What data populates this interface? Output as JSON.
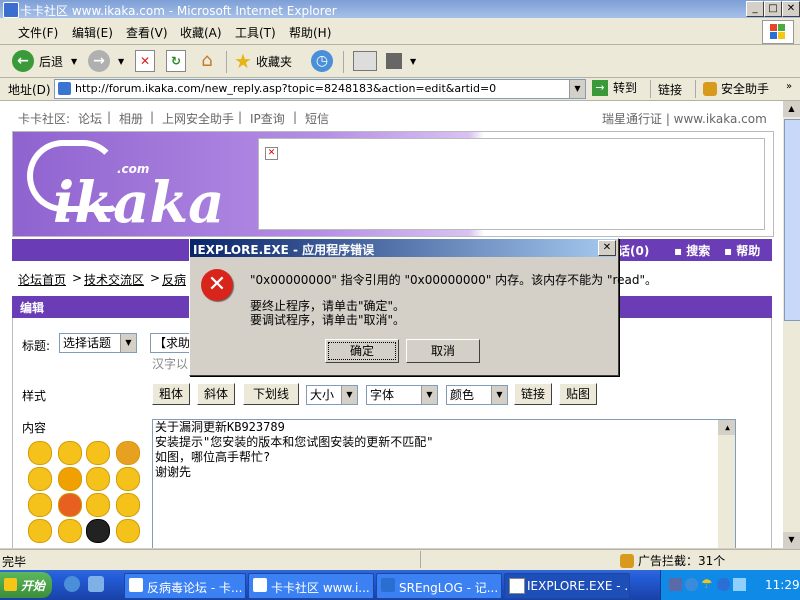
{
  "window": {
    "title": "卡卡社区 www.ikaka.com - Microsoft Internet Explorer"
  },
  "menu": [
    "文件(F)",
    "编辑(E)",
    "查看(V)",
    "收藏(A)",
    "工具(T)",
    "帮助(H)"
  ],
  "toolbar": {
    "back_label": "后退",
    "favorites_label": "收藏夹"
  },
  "address": {
    "label": "地址(D)",
    "url": "http://forum.ikaka.com/new_reply.asp?topic=8248183&action=edit&artid=0",
    "go_label": "转到",
    "links_label": "链接",
    "assistant_label": "安全助手"
  },
  "page": {
    "topnav": [
      "卡卡社区:",
      "论坛",
      "|",
      "相册",
      "|",
      "上网安全助手",
      "|",
      "IP查询",
      "|",
      "短信"
    ],
    "topnav_right": "瑞星通行证 | www.ikaka.com",
    "logo_text": "ikaka",
    "logo_com": ".com",
    "nav_right": [
      "话(0)",
      "▪ 搜索",
      "▪ 帮助"
    ],
    "breadcrumbs": [
      "论坛首页",
      ">",
      "技术交流区",
      ">",
      "反病"
    ],
    "edit_header": "编辑",
    "title_label": "标题:",
    "topic_select": "选择话题",
    "title_value": "【求助",
    "title_hint": "汉字以",
    "style_label": "样式",
    "style_buttons": [
      "粗体",
      "斜体",
      "下划线"
    ],
    "size_select": "大小",
    "font_select": "字体",
    "color_select": "颜色",
    "link_button": "链接",
    "image_button": "贴图",
    "content_label": "内容",
    "content_lines": [
      "关于漏洞更新KB923789",
      "安装提示\"您安装的版本和您试图安装的更新不匹配\"",
      "如图，哪位高手帮忙?",
      "谢谢先"
    ]
  },
  "dialog": {
    "title": "IEXPLORE.EXE - 应用程序错误",
    "message": "\"0x00000000\" 指令引用的 \"0x00000000\" 内存。该内存不能为 \"read\"。",
    "line_terminate": "要终止程序，请单击\"确定\"。",
    "line_debug": "要调试程序，请单击\"取消\"。",
    "ok_label": "确定",
    "cancel_label": "取消"
  },
  "status": {
    "text": "完毕",
    "popup_blocked": "广告拦截：31个"
  },
  "taskbar": {
    "start_label": "开始",
    "items": [
      "反病毒论坛 - 卡...",
      "卡卡社区 www.i...",
      "SREngLOG - 记...",
      "IEXPLORE.EXE - ..."
    ],
    "clock": "11:29"
  }
}
